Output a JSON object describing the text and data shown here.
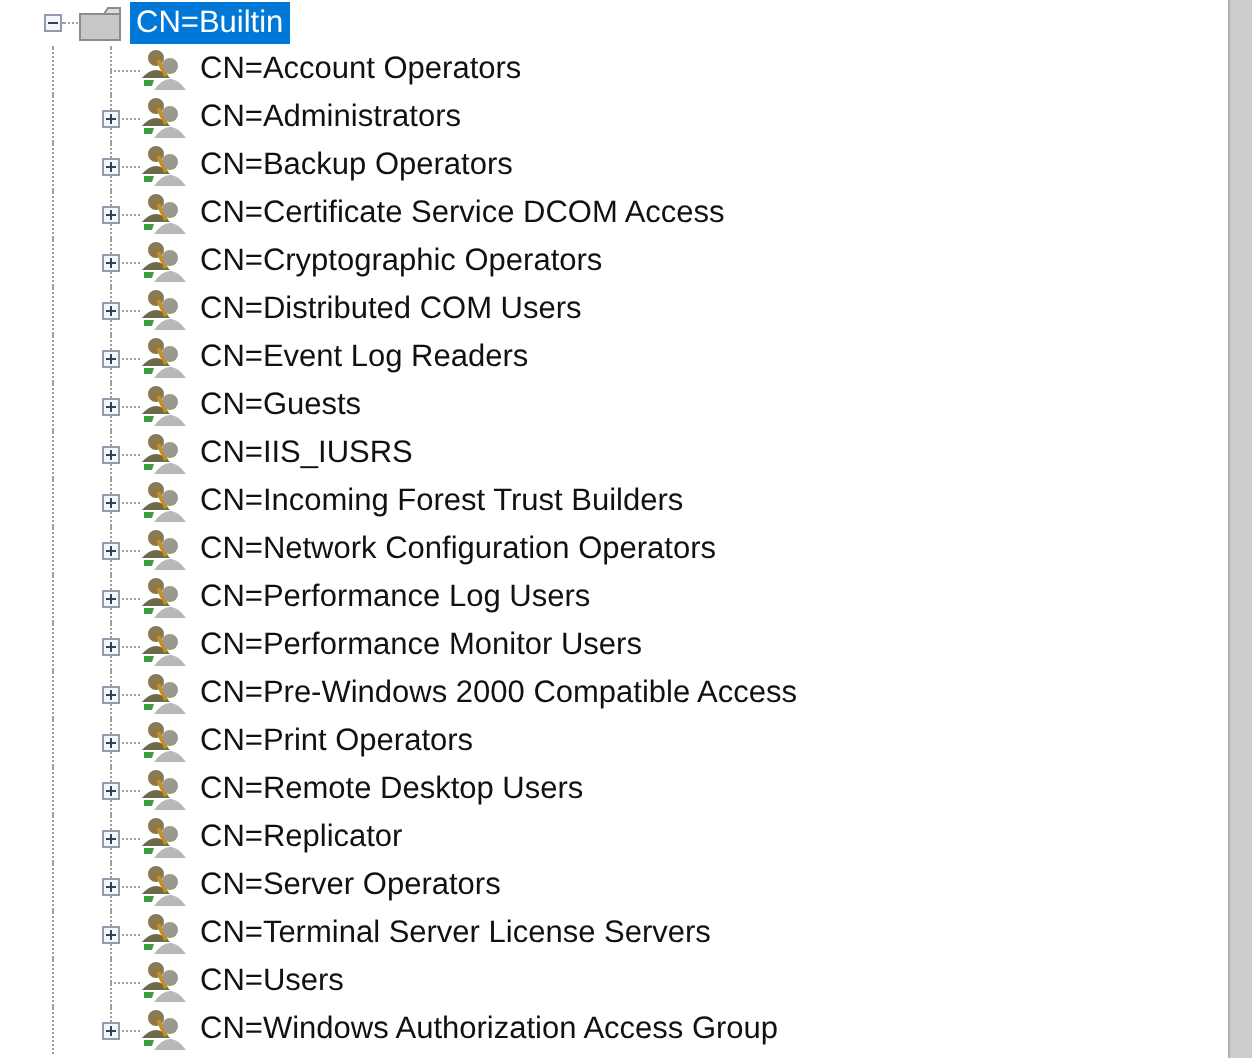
{
  "tree": {
    "label": "CN=Builtin",
    "expanded": true,
    "selected": true,
    "children": [
      {
        "label": "CN=Account Operators",
        "has_children": false
      },
      {
        "label": "CN=Administrators",
        "has_children": true
      },
      {
        "label": "CN=Backup Operators",
        "has_children": true
      },
      {
        "label": "CN=Certificate Service DCOM Access",
        "has_children": true
      },
      {
        "label": "CN=Cryptographic Operators",
        "has_children": true
      },
      {
        "label": "CN=Distributed COM Users",
        "has_children": true
      },
      {
        "label": "CN=Event Log Readers",
        "has_children": true
      },
      {
        "label": "CN=Guests",
        "has_children": true
      },
      {
        "label": "CN=IIS_IUSRS",
        "has_children": true
      },
      {
        "label": "CN=Incoming Forest Trust Builders",
        "has_children": true
      },
      {
        "label": "CN=Network Configuration Operators",
        "has_children": true
      },
      {
        "label": "CN=Performance Log Users",
        "has_children": true
      },
      {
        "label": "CN=Performance Monitor Users",
        "has_children": true
      },
      {
        "label": "CN=Pre-Windows 2000 Compatible Access",
        "has_children": true
      },
      {
        "label": "CN=Print Operators",
        "has_children": true
      },
      {
        "label": "CN=Remote Desktop Users",
        "has_children": true
      },
      {
        "label": "CN=Replicator",
        "has_children": true
      },
      {
        "label": "CN=Server Operators",
        "has_children": true
      },
      {
        "label": "CN=Terminal Server License Servers",
        "has_children": true
      },
      {
        "label": "CN=Users",
        "has_children": false
      },
      {
        "label": "CN=Windows Authorization Access Group",
        "has_children": true
      }
    ]
  }
}
